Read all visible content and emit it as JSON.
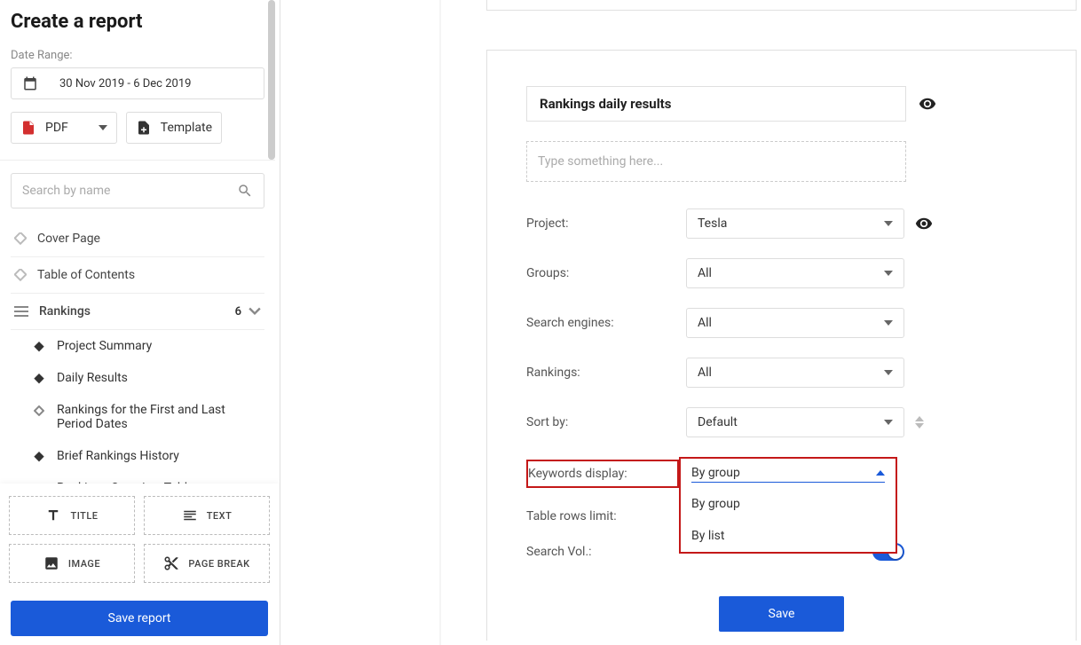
{
  "sidebar": {
    "title": "Create a report",
    "date_label": "Date Range:",
    "date_range": "30 Nov 2019 - 6 Dec 2019",
    "format_label": "PDF",
    "template_label": "Template",
    "search_placeholder": "Search by name",
    "nav": {
      "cover_page": "Cover Page",
      "toc": "Table of Contents",
      "rankings": "Rankings",
      "rankings_count": "6"
    },
    "sub_items": [
      "Project Summary",
      "Daily Results",
      "Rankings for the First and Last Period Dates",
      "Brief Rankings History",
      "Rankings Overview Table"
    ],
    "tools": {
      "title": "TITLE",
      "text": "TEXT",
      "image": "IMAGE",
      "page_break": "PAGE BREAK"
    },
    "save_button": "Save report"
  },
  "main": {
    "section_title": "Rankings daily results",
    "textarea_placeholder": "Type something here...",
    "rows": {
      "project": {
        "label": "Project:",
        "value": "Tesla"
      },
      "groups": {
        "label": "Groups:",
        "value": "All"
      },
      "search_engines": {
        "label": "Search engines:",
        "value": "All"
      },
      "rankings": {
        "label": "Rankings:",
        "value": "All"
      },
      "sort_by": {
        "label": "Sort by:",
        "value": "Default"
      },
      "keywords": {
        "label": "Keywords display:",
        "value": "By group",
        "options": [
          "By group",
          "By list"
        ]
      },
      "table_rows": {
        "label": "Table rows limit:"
      },
      "search_vol": {
        "label": "Search Vol.:"
      }
    },
    "save_button": "Save"
  }
}
